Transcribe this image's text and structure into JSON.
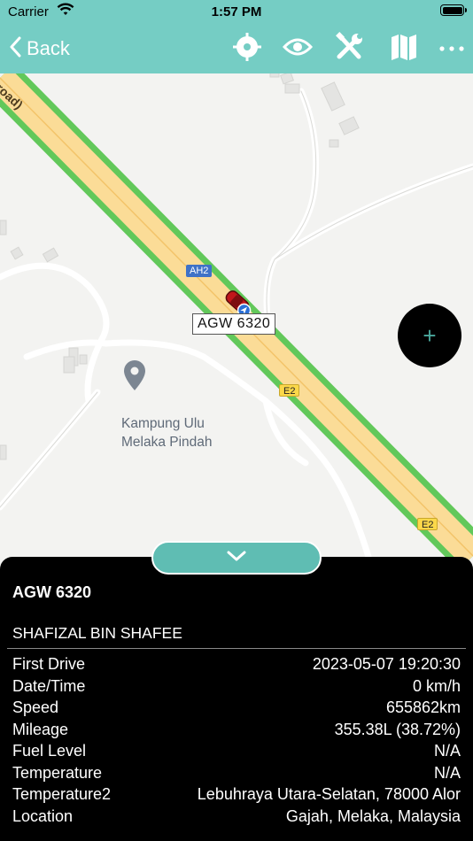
{
  "status_bar": {
    "carrier": "Carrier",
    "time": "1:57 PM",
    "battery_level": 1.0
  },
  "nav_bar": {
    "back_label": "Back",
    "icons": [
      "locate-icon",
      "eye-icon",
      "tools-icon",
      "map-icon",
      "more-icon"
    ],
    "background": "#75cdc4"
  },
  "map": {
    "vehicle_plate": "AGW 6320",
    "place_name_line1": "Kampung Ulu",
    "place_name_line2": "Melaka Pindah",
    "road_label": "road)",
    "shield_ah2": "AH2",
    "shield_e2_a": "E2",
    "shield_e2_b": "E2",
    "fab_symbol": "+"
  },
  "panel": {
    "vehicle_title": "AGW 6320",
    "driver": "SHAFIZAL BIN SHAFEE",
    "rows": [
      {
        "label": "First Drive",
        "value": "2023-05-07 19:20:30"
      },
      {
        "label": "Date/Time",
        "value": "0 km/h"
      },
      {
        "label": "Speed",
        "value": "655862km"
      },
      {
        "label": "Mileage",
        "value": "355.38L (38.72%)"
      },
      {
        "label": "Fuel Level",
        "value": "N/A"
      },
      {
        "label": "Temperature",
        "value": "N/A"
      },
      {
        "label": "Temperature2",
        "value": "Lebuhraya Utara-Selatan, 78000 Alor"
      },
      {
        "label": "Location",
        "value": "Gajah, Melaka, Malaysia"
      }
    ]
  },
  "colors": {
    "accent": "#75cdc4",
    "highway_fill": "#fbdc97",
    "highway_border": "#62c85a",
    "panel_bg": "#000000"
  }
}
